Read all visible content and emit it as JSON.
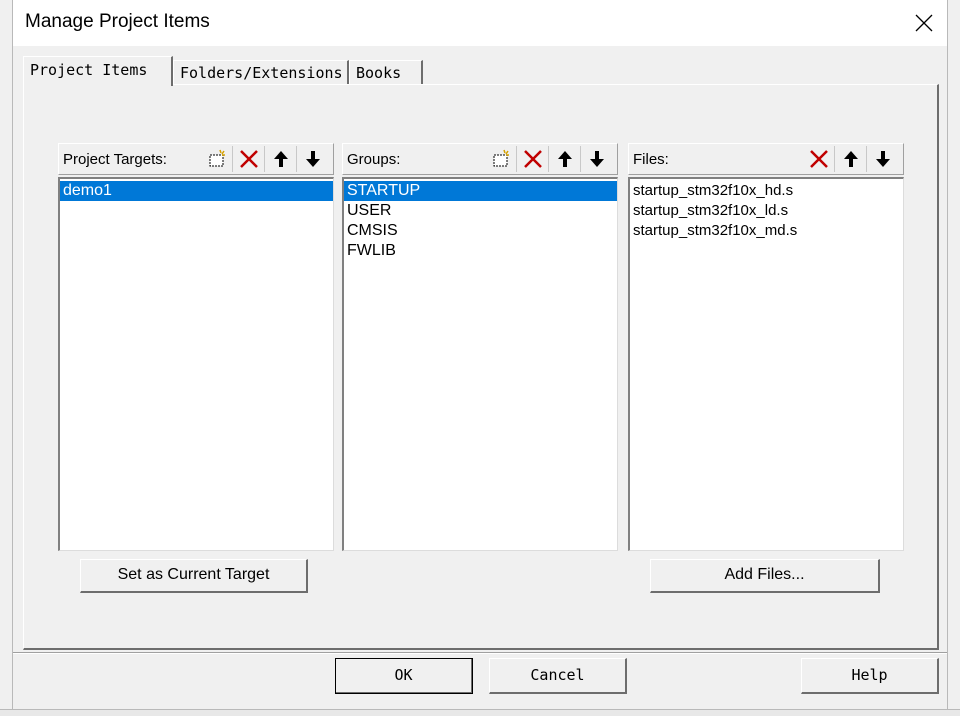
{
  "window": {
    "title": "Manage Project Items"
  },
  "tabs": [
    {
      "label": "Project Items"
    },
    {
      "label": "Folders/Extensions"
    },
    {
      "label": "Books"
    }
  ],
  "targets": {
    "label": "Project Targets:",
    "items": [
      "demo1"
    ],
    "selected": "demo1",
    "button": "Set as Current Target"
  },
  "groups": {
    "label": "Groups:",
    "items": [
      "STARTUP",
      "USER",
      "CMSIS",
      "FWLIB"
    ],
    "selected": "STARTUP"
  },
  "files": {
    "label": "Files:",
    "items": [
      "startup_stm32f10x_hd.s",
      "startup_stm32f10x_ld.s",
      "startup_stm32f10x_md.s"
    ],
    "button": "Add Files..."
  },
  "footer": {
    "ok": "OK",
    "cancel": "Cancel",
    "help": "Help"
  },
  "colors": {
    "selection": "#0078d7",
    "delete_icon": "#c00000"
  },
  "icons": [
    "new-item-icon",
    "delete-icon",
    "move-up-icon",
    "move-down-icon",
    "close-icon"
  ]
}
